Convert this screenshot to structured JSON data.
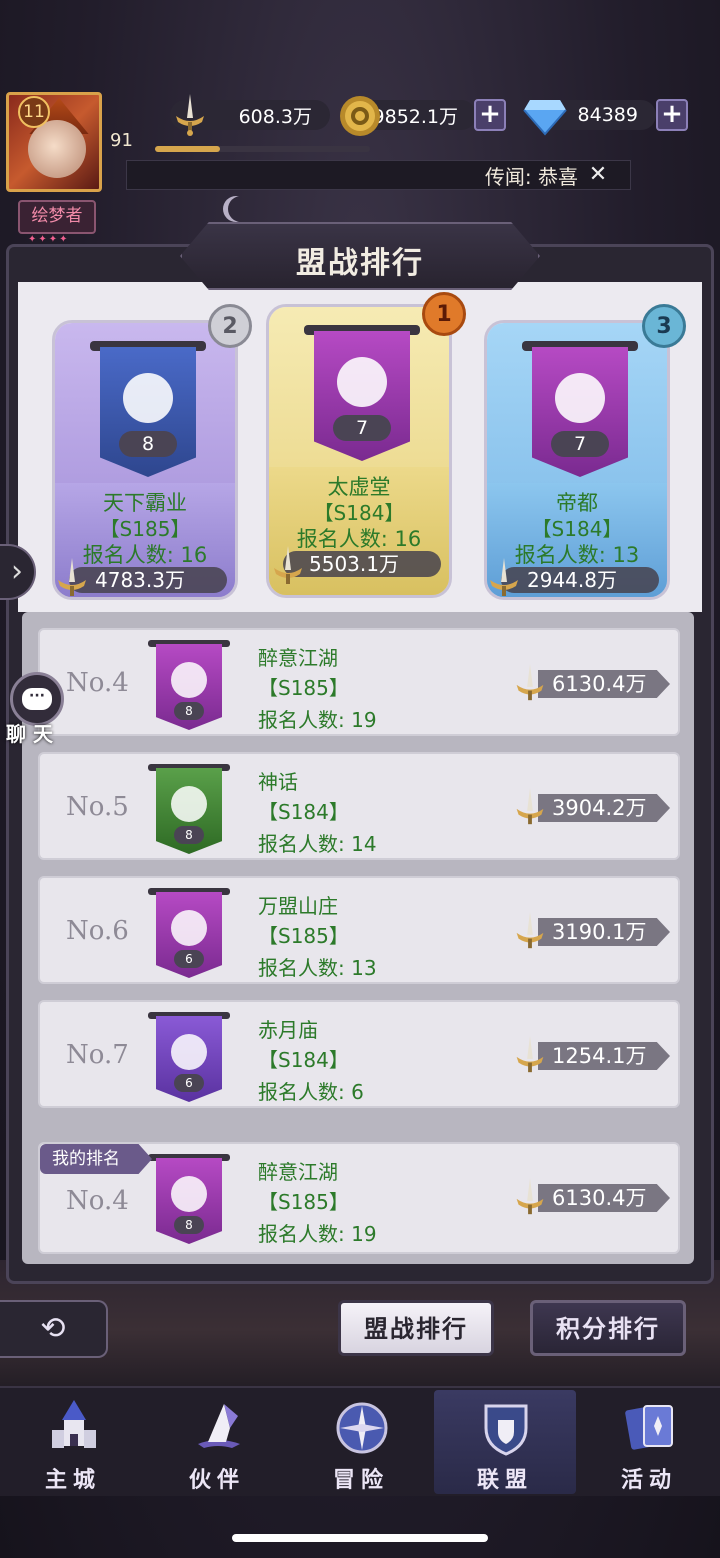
{
  "colors": {
    "accent_green": "#2c7a2a",
    "gold": "#d6a64d"
  },
  "player": {
    "level_badge": "11",
    "level": "91",
    "exp_fraction": 0.3,
    "role": "绘梦者",
    "role_gems": "✦✦✦✦"
  },
  "resources": {
    "power": {
      "icon": "sword-icon",
      "value": "608.3万"
    },
    "gold": {
      "icon": "coin-icon",
      "value": "9852.1万"
    },
    "diamond": {
      "icon": "diamond-icon",
      "value": "84389"
    },
    "plus_label": "+"
  },
  "rumor": {
    "text": "传闻:  恭喜",
    "close": "✕"
  },
  "panel": {
    "title": "盟战排行"
  },
  "podium": [
    {
      "rank": "2",
      "name": "天下霸业",
      "server": "【S185】",
      "signup": "报名人数: 16",
      "banner_num": "8",
      "power": "4783.3万"
    },
    {
      "rank": "1",
      "name": "太虚堂",
      "server": "【S184】",
      "signup": "报名人数: 16",
      "banner_num": "7",
      "power": "5503.1万"
    },
    {
      "rank": "3",
      "name": "帝都",
      "server": "【S184】",
      "signup": "报名人数: 13",
      "banner_num": "7",
      "power": "2944.8万"
    }
  ],
  "rows": [
    {
      "no": "No.4",
      "name": "醉意江湖",
      "server": "【S185】",
      "signup": "报名人数: 19",
      "banner_num": "8",
      "power": "6130.4万"
    },
    {
      "no": "No.5",
      "name": "神话",
      "server": "【S184】",
      "signup": "报名人数: 14",
      "banner_num": "8",
      "power": "3904.2万"
    },
    {
      "no": "No.6",
      "name": "万盟山庄",
      "server": "【S185】",
      "signup": "报名人数: 13",
      "banner_num": "6",
      "power": "3190.1万"
    },
    {
      "no": "No.7",
      "name": "赤月庙",
      "server": "【S184】",
      "signup": "报名人数: 6",
      "banner_num": "6",
      "power": "1254.1万"
    }
  ],
  "my_rank": {
    "tag": "我的排名",
    "no": "No.4",
    "name": "醉意江湖",
    "server": "【S185】",
    "signup": "报名人数: 19",
    "banner_num": "8",
    "power": "6130.4万"
  },
  "side": {
    "arrow": "›",
    "chat_bubble": "···",
    "chat_label": "聊 天"
  },
  "tabs": {
    "back": "⟲",
    "active": "盟战排行",
    "inactive": "积分排行"
  },
  "nav": [
    {
      "label": "主城",
      "icon": "castle-icon"
    },
    {
      "label": "伙伴",
      "icon": "witch-hat-icon"
    },
    {
      "label": "冒险",
      "icon": "compass-icon"
    },
    {
      "label": "联盟",
      "icon": "shield-icon"
    },
    {
      "label": "活动",
      "icon": "cards-icon"
    }
  ]
}
